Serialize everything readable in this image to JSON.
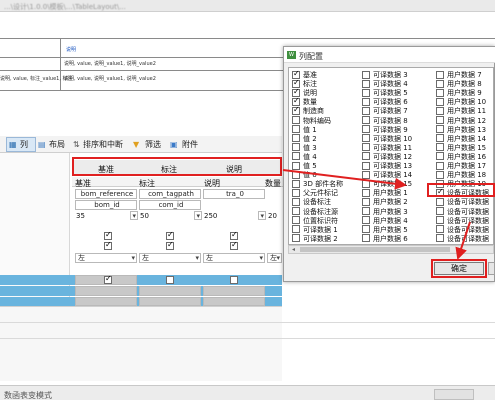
{
  "window": {
    "title_path": "...\\设计\\1.0.0\\模板\\...\\TableLayout\\...",
    "blurred": true
  },
  "doc": {
    "row1": "说明",
    "row2_a": "说明, value, 说明_value1, 说明_value2",
    "row3_a": "说明, value, 标注_value1, 标注",
    "row3_b": "说明, value, 说明_value1, 说明_value2"
  },
  "tabs": [
    {
      "label": "列",
      "icon": "columns-icon"
    },
    {
      "label": "布局",
      "icon": "layout-icon"
    },
    {
      "label": "排序和中断",
      "icon": "sort-icon"
    },
    {
      "label": "筛选",
      "icon": "filter-icon"
    },
    {
      "label": "附件",
      "icon": "attachment-icon"
    }
  ],
  "grid": {
    "group_headers": [
      "基准",
      "标注",
      "说明"
    ],
    "headers": [
      "基准",
      "标注",
      "说明",
      "数量"
    ],
    "property_row": [
      "bom_reference",
      "com_tagpath",
      "tra_0"
    ],
    "id_row": [
      "bom_id",
      "com_id"
    ],
    "width_row": [
      "35",
      "50",
      "250",
      "20"
    ],
    "align_row": [
      "左",
      "左",
      "左",
      "左"
    ]
  },
  "dialog": {
    "title": "列配置",
    "ok_label": "确定",
    "col1": [
      {
        "label": "基准",
        "checked": true
      },
      {
        "label": "标注",
        "checked": true
      },
      {
        "label": "说明",
        "checked": true
      },
      {
        "label": "数量",
        "checked": true
      },
      {
        "label": "制造商",
        "checked": true
      },
      {
        "label": "物料编码",
        "checked": false
      },
      {
        "label": "值 1",
        "checked": false
      },
      {
        "label": "值 2",
        "checked": false
      },
      {
        "label": "值 3",
        "checked": false
      },
      {
        "label": "值 4",
        "checked": false
      },
      {
        "label": "值 5",
        "checked": false
      },
      {
        "label": "值 6",
        "checked": false
      },
      {
        "label": "3D 部件名称",
        "checked": false
      },
      {
        "label": "父元件标记",
        "checked": false
      },
      {
        "label": "设备标注",
        "checked": false
      },
      {
        "label": "设备标注源",
        "checked": false
      },
      {
        "label": "位置标识符",
        "checked": false
      },
      {
        "label": "可译数据 1",
        "checked": false
      },
      {
        "label": "可译数据 2",
        "checked": false
      }
    ],
    "col2": [
      {
        "label": "可译数据 3",
        "checked": false
      },
      {
        "label": "可译数据 4",
        "checked": false
      },
      {
        "label": "可译数据 5",
        "checked": false
      },
      {
        "label": "可译数据 6",
        "checked": false
      },
      {
        "label": "可译数据 7",
        "checked": false
      },
      {
        "label": "可译数据 8",
        "checked": false
      },
      {
        "label": "可译数据 9",
        "checked": false
      },
      {
        "label": "可译数据 10",
        "checked": false
      },
      {
        "label": "可译数据 11",
        "checked": false
      },
      {
        "label": "可译数据 12",
        "checked": false
      },
      {
        "label": "可译数据 13",
        "checked": false
      },
      {
        "label": "可译数据 14",
        "checked": false
      },
      {
        "label": "可译数据 15",
        "checked": false
      },
      {
        "label": "用户数据 1",
        "checked": false
      },
      {
        "label": "用户数据 2",
        "checked": false
      },
      {
        "label": "用户数据 3",
        "checked": false
      },
      {
        "label": "用户数据 4",
        "checked": false
      },
      {
        "label": "用户数据 5",
        "checked": false
      },
      {
        "label": "用户数据 6",
        "checked": false
      }
    ],
    "col3": [
      {
        "label": "用户数据 7",
        "checked": false
      },
      {
        "label": "用户数据 8",
        "checked": false
      },
      {
        "label": "用户数据 9",
        "checked": false
      },
      {
        "label": "用户数据 10",
        "checked": false
      },
      {
        "label": "用户数据 11",
        "checked": false
      },
      {
        "label": "用户数据 12",
        "checked": false
      },
      {
        "label": "用户数据 13",
        "checked": false
      },
      {
        "label": "用户数据 14",
        "checked": false
      },
      {
        "label": "用户数据 15",
        "checked": false
      },
      {
        "label": "用户数据 16",
        "checked": false
      },
      {
        "label": "用户数据 17",
        "checked": false
      },
      {
        "label": "用户数据 18",
        "checked": false
      },
      {
        "label": "用户数据 19",
        "checked": false
      },
      {
        "label": "设备可译数据",
        "checked": true
      },
      {
        "label": "设备可译数据",
        "checked": false
      },
      {
        "label": "设备可译数据",
        "checked": false
      },
      {
        "label": "设备可译数据",
        "checked": false
      },
      {
        "label": "设备可译数据",
        "checked": false
      },
      {
        "label": "设备可译数据",
        "checked": false
      }
    ]
  },
  "status_bar": {
    "text": "数函表变模式"
  },
  "colors": {
    "highlight_red": "#e02020",
    "selected_blue": "#69b4de",
    "dialog_bg": "#f0f0f0"
  }
}
